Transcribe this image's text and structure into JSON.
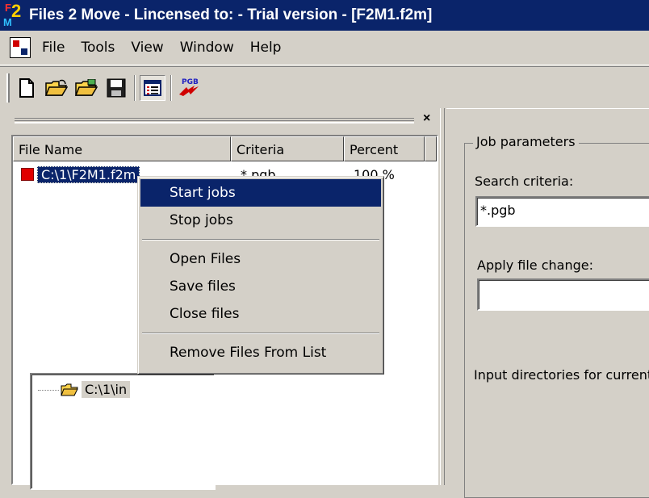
{
  "window": {
    "title": "Files 2 Move - Lincensed to:  - Trial version - [F2M1.f2m]",
    "icon_logo": "F2M"
  },
  "menubar": {
    "items": [
      "File",
      "Tools",
      "View",
      "Window",
      "Help"
    ]
  },
  "toolbar": {
    "buttons": [
      "new-document-icon",
      "open-folder-icon",
      "open-recent-icon",
      "save-disk-icon",
      "list-view-icon",
      "pgb-convert-icon"
    ],
    "pgb_icon_text": "PGB"
  },
  "file_list": {
    "close_glyph": "×",
    "columns": [
      "File Name",
      "Criteria",
      "Percent"
    ],
    "rows": [
      {
        "name": "C:\\1\\F2M1.f2m",
        "criteria": "*.pgb",
        "percent": "100 %",
        "status_color": "#e00000"
      }
    ]
  },
  "context_menu": {
    "items": [
      {
        "label": "Start jobs",
        "highlighted": true
      },
      {
        "label": "Stop jobs"
      },
      {
        "separator": true
      },
      {
        "label": "Open Files"
      },
      {
        "label": "Save files"
      },
      {
        "label": "Close files"
      },
      {
        "separator": true
      },
      {
        "label": "Remove Files From List"
      }
    ]
  },
  "job_parameters": {
    "group_title": "Job parameters",
    "search_criteria_label": "Search criteria:",
    "search_criteria_value": "*.pgb",
    "apply_change_label": "Apply file change:",
    "apply_change_value": "",
    "input_dirs_label": "Input directories for current job",
    "input_dirs": [
      "C:\\1\\in"
    ]
  },
  "colors": {
    "title_bar": "#0a246a",
    "face": "#d4d0c8",
    "highlight": "#0a246a"
  }
}
